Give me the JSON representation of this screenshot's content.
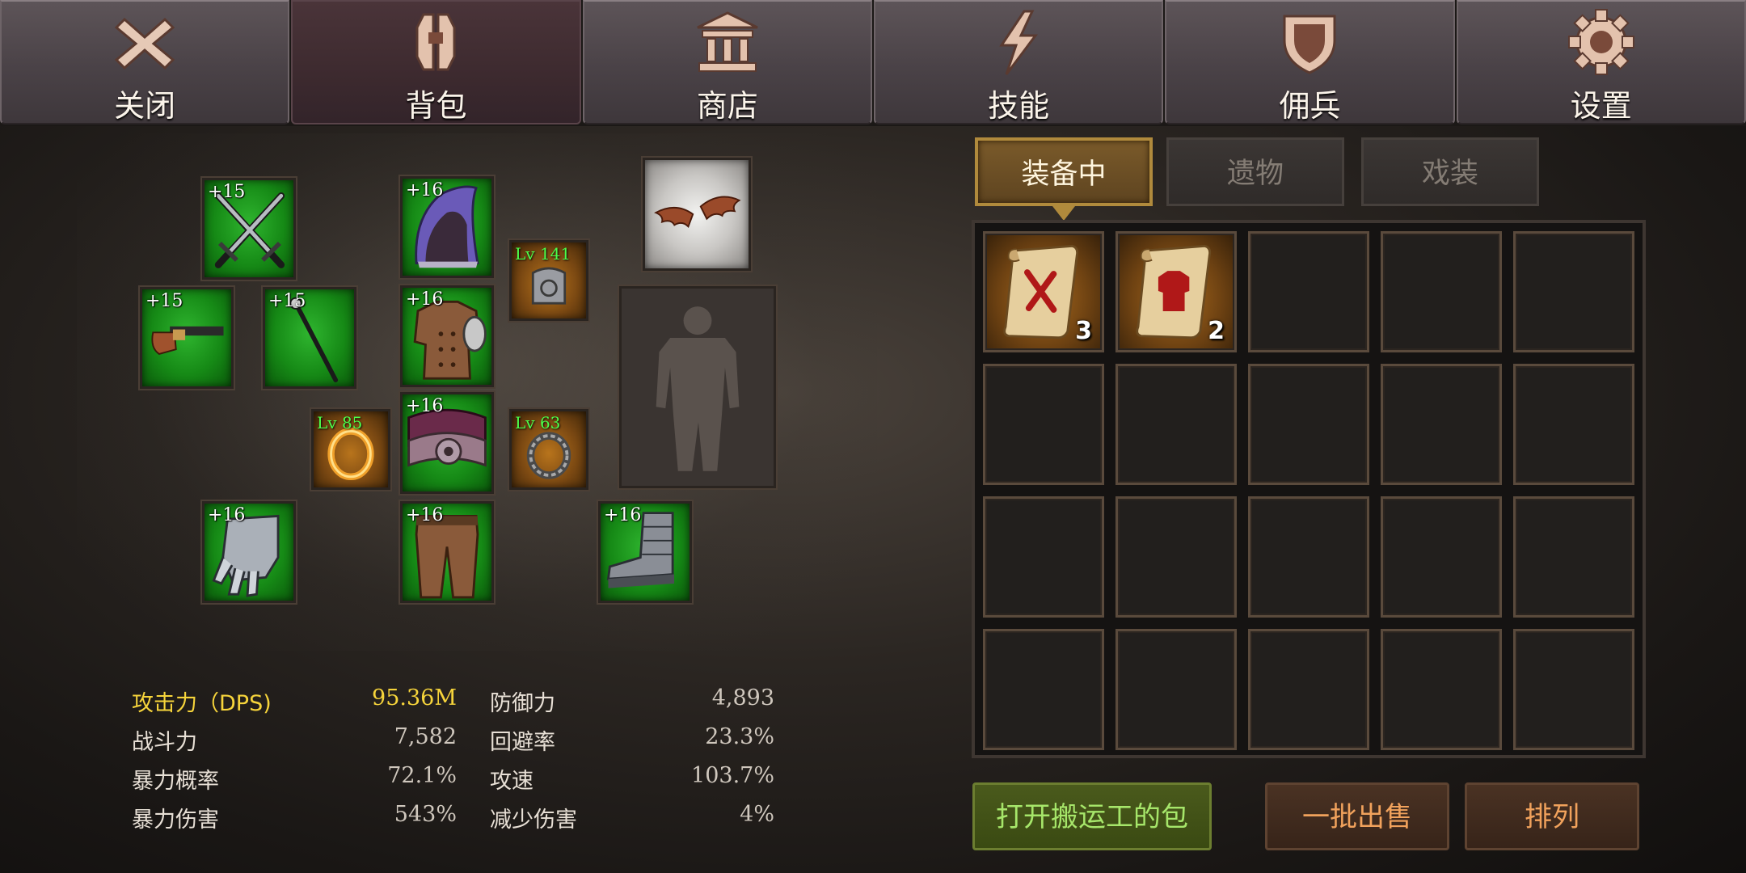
{
  "nav": {
    "tabs": [
      {
        "label": "关闭",
        "icon": "close-icon"
      },
      {
        "label": "背包",
        "icon": "backpack-icon"
      },
      {
        "label": "商店",
        "icon": "shop-icon"
      },
      {
        "label": "技能",
        "icon": "lightning-icon"
      },
      {
        "label": "佣兵",
        "icon": "shield-icon"
      },
      {
        "label": "设置",
        "icon": "gear-icon"
      }
    ],
    "active_index": 1
  },
  "equipment": {
    "slots": [
      {
        "name": "weapon-crossed-swords",
        "tag": "+15",
        "rarity": "green"
      },
      {
        "name": "hood",
        "tag": "+16",
        "rarity": "green"
      },
      {
        "name": "wings",
        "tag": "",
        "rarity": "grey"
      },
      {
        "name": "pistol",
        "tag": "+15",
        "rarity": "green"
      },
      {
        "name": "staff",
        "tag": "+15",
        "rarity": "green"
      },
      {
        "name": "chest-armor",
        "tag": "+16",
        "rarity": "green"
      },
      {
        "name": "necklace",
        "tag": "Lv 141",
        "rarity": "orange"
      },
      {
        "name": "ring-left",
        "tag": "Lv 85",
        "rarity": "orange"
      },
      {
        "name": "belt",
        "tag": "+16",
        "rarity": "green"
      },
      {
        "name": "ring-right",
        "tag": "Lv 63",
        "rarity": "orange"
      },
      {
        "name": "gauntlets",
        "tag": "+16",
        "rarity": "green"
      },
      {
        "name": "pants",
        "tag": "+16",
        "rarity": "green"
      },
      {
        "name": "boots",
        "tag": "+16",
        "rarity": "green"
      }
    ]
  },
  "stats": {
    "left": [
      {
        "label": "攻击力（DPS)",
        "value": "95.36M",
        "highlight": true
      },
      {
        "label": "战斗力",
        "value": "7,582"
      },
      {
        "label": "暴力概率",
        "value": "72.1%"
      },
      {
        "label": "暴力伤害",
        "value": "543%"
      }
    ],
    "right": [
      {
        "label": "防御力",
        "value": "4,893"
      },
      {
        "label": "回避率",
        "value": "23.3%"
      },
      {
        "label": "攻速",
        "value": "103.7%"
      },
      {
        "label": "减少伤害",
        "value": "4%"
      }
    ]
  },
  "inventory": {
    "tabs": [
      "装备中",
      "遗物",
      "戏装"
    ],
    "active_tab": 0,
    "items": [
      {
        "icon": "scroll-sword-icon",
        "count": "3"
      },
      {
        "icon": "scroll-armor-icon",
        "count": "2"
      }
    ],
    "total_cells": 20
  },
  "buttons": {
    "open_porter_bag": "打开搬运工的包",
    "batch_sell": "一批出售",
    "sort": "排列"
  },
  "colors": {
    "highlight": "#f6d43b",
    "green_rarity": "#1e9a1e",
    "orange_rarity": "#8a5414",
    "tab_active_gold": "#b08a3c"
  }
}
